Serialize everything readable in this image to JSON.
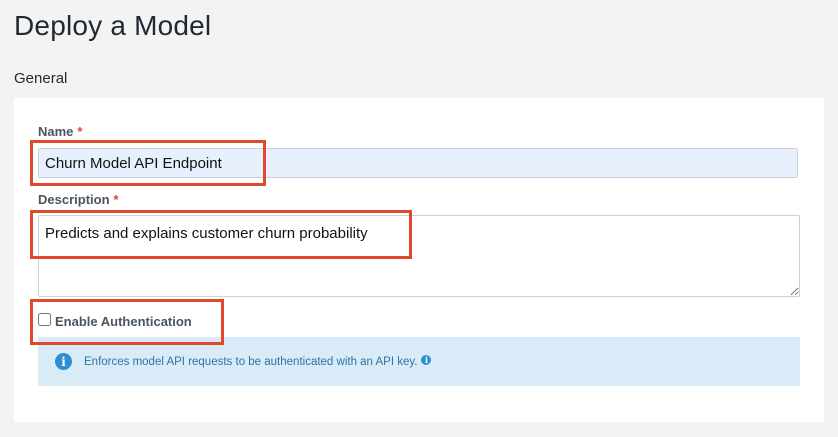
{
  "page": {
    "title": "Deploy a Model",
    "section": "General"
  },
  "form": {
    "name": {
      "label": "Name",
      "required_marker": "*",
      "value": "Churn Model API Endpoint"
    },
    "description": {
      "label": "Description",
      "required_marker": "*",
      "value": "Predicts and explains customer churn probability"
    },
    "authentication": {
      "label": "Enable Authentication",
      "checked": false,
      "info_text": "Enforces model API requests to be authenticated with an API key.",
      "info_icon": "info-icon"
    }
  },
  "colors": {
    "highlight": "#e0492b",
    "required": "#d9442b",
    "info_bg": "#d8ebf6",
    "info_icon": "#2d8fd0"
  }
}
